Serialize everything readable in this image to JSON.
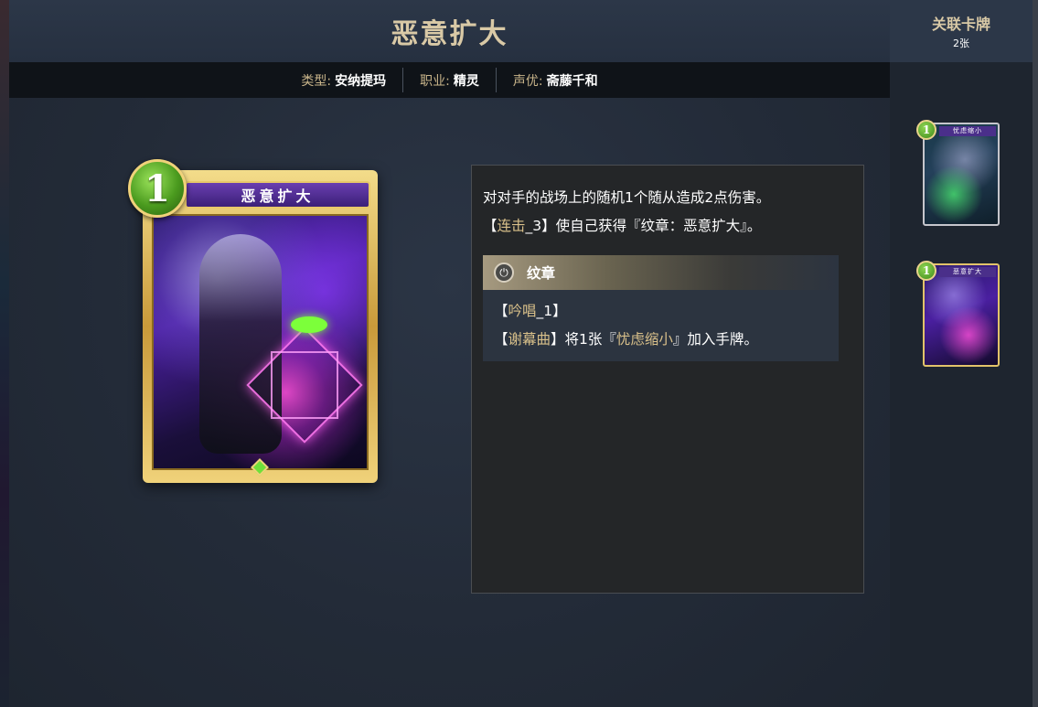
{
  "card": {
    "name": "恶意扩大",
    "cost": "1",
    "info": [
      {
        "key": "类型:",
        "value": "安纳提玛"
      },
      {
        "key": "职业:",
        "value": "精灵"
      },
      {
        "key": "声优:",
        "value": "斋藤千和"
      }
    ]
  },
  "description": {
    "line1": "对对手的战场上的随机1个随从造成2点伤害。",
    "line2_open": "【",
    "line2_kw": "连击",
    "line2_rest": "_3】使自己获得『纹章：恶意扩大』。",
    "crest": {
      "title": "纹章",
      "line1_open": "【",
      "line1_kw": "吟唱",
      "line1_rest": "_1】",
      "line2_open": "【",
      "line2_kw": "谢幕曲",
      "line2_mid": "】将1张『",
      "line2_kw2": "忧虑缩小",
      "line2_end": "』加入手牌。"
    }
  },
  "related": {
    "title": "关联卡牌",
    "count": "2张",
    "cards": [
      {
        "name": "忧虑缩小",
        "cost": "1",
        "frame": "silver"
      },
      {
        "name": "恶意扩大",
        "cost": "1",
        "frame": "gold"
      }
    ]
  },
  "colors": {
    "title_gold": "#d9c9a6",
    "keyword": "#d9c08a",
    "cost_green": "#4a9a1e"
  }
}
